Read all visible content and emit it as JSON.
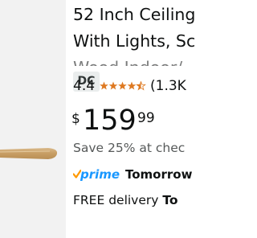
{
  "product": {
    "title_lines": [
      "52 Inch Ceiling",
      "With Lights, Sc",
      "Wood Indoor/..."
    ],
    "badge": "DC",
    "rating": "4.4",
    "rating_value": 4.4,
    "reviews": "(1.3K",
    "price_symbol": "$",
    "price_whole": "159",
    "price_fraction": "99",
    "savings": "Save 25% at chec",
    "prime_label": "prime",
    "prime_delivery": "Tomorrow",
    "free_delivery_prefix": "FREE delivery ",
    "free_delivery_day": "To"
  },
  "colors": {
    "star": "#de7921",
    "prime_blue": "#1a98ff",
    "prime_check": "#ff9900",
    "image_bg": "#f2f2f2",
    "blade": "#c9a36e"
  },
  "icons": {
    "stars": "star-rating-icon",
    "prime_check": "prime-check-icon"
  }
}
